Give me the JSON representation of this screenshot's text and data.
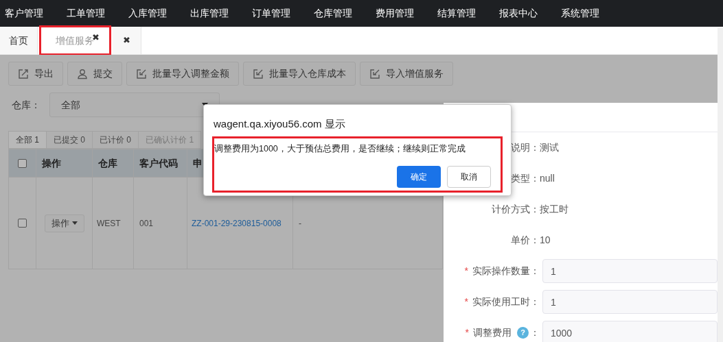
{
  "nav": {
    "items": [
      {
        "label": "客户管理"
      },
      {
        "label": "工单管理"
      },
      {
        "label": "入库管理"
      },
      {
        "label": "出库管理"
      },
      {
        "label": "订单管理"
      },
      {
        "label": "仓库管理"
      },
      {
        "label": "费用管理"
      },
      {
        "label": "结算管理"
      },
      {
        "label": "报表中心"
      },
      {
        "label": "系统管理"
      }
    ]
  },
  "page_tabs": [
    {
      "label": "首页",
      "selected": false,
      "closable": false,
      "highlighted": false
    },
    {
      "label": "增值服务",
      "selected": true,
      "closable": true,
      "highlighted": true
    },
    {
      "selected": false,
      "closable": true,
      "highlighted": false
    }
  ],
  "close_glyph": "✖",
  "toolbar": [
    {
      "label": "导出"
    },
    {
      "label": "提交"
    },
    {
      "label": "批量导入调整金额"
    },
    {
      "label": "批量导入仓库成本"
    },
    {
      "label": "导入增值服务"
    }
  ],
  "filter": {
    "label": "仓库：",
    "value": "全部"
  },
  "status_tabs": [
    {
      "label": "全部 1",
      "selected": true
    },
    {
      "label": "已提交 0",
      "selected": false
    },
    {
      "label": "已计价 0",
      "selected": false
    },
    {
      "label": "已确认计价 1",
      "selected": false
    }
  ],
  "table": {
    "header_checked": false,
    "columns": [
      "操作",
      "仓库",
      "客户代码",
      "申"
    ],
    "rows": [
      {
        "checked": false,
        "action": "操作",
        "warehouse": "WEST",
        "customer_code": "001",
        "order_no": "ZZ-001-29-230815-0008",
        "column_6": "-"
      }
    ]
  },
  "drawer": {
    "fields": [
      {
        "kind": "text",
        "label": "说明：",
        "value": "测试"
      },
      {
        "kind": "text",
        "label": "类型：",
        "value": "null"
      },
      {
        "kind": "text",
        "label": "计价方式：",
        "value": "按工时"
      },
      {
        "kind": "text",
        "label": "单价：",
        "value": "10"
      },
      {
        "kind": "input",
        "label": "实际操作数量：",
        "value": "1",
        "required": true,
        "help": false
      },
      {
        "kind": "input",
        "label": "实际使用工时：",
        "value": "1",
        "required": true,
        "help": false
      },
      {
        "kind": "input",
        "label": "调整费用",
        "value": "1000",
        "required": true,
        "help": true
      }
    ]
  },
  "required_mark": "*",
  "help_glyph": "?",
  "colon": "：",
  "dialog": {
    "title": "wagent.qa.xiyou56.com 显示",
    "message": "调整费用为1000，大于预估总费用，是否继续；继续则正常完成",
    "highlighted": true,
    "buttons": [
      {
        "label": "确定",
        "kind": "primary"
      },
      {
        "label": "取消",
        "kind": "secondary"
      }
    ]
  }
}
